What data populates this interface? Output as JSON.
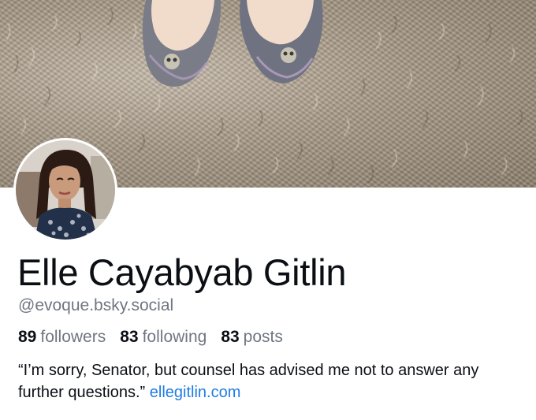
{
  "profile": {
    "display_name": "Elle Cayabyab Gitlin",
    "handle": "@evoque.bsky.social",
    "stats": {
      "followers_count": "89",
      "followers_label": "followers",
      "following_count": "83",
      "following_label": "following",
      "posts_count": "83",
      "posts_label": "posts"
    },
    "bio": {
      "text": "“I’m sorry, Senator, but counsel has advised me not to answer any further questions.”",
      "link": "ellegitlin.com"
    }
  },
  "colors": {
    "text": "#0b0f14",
    "muted": "#6f7681",
    "link": "#1f7de6"
  }
}
